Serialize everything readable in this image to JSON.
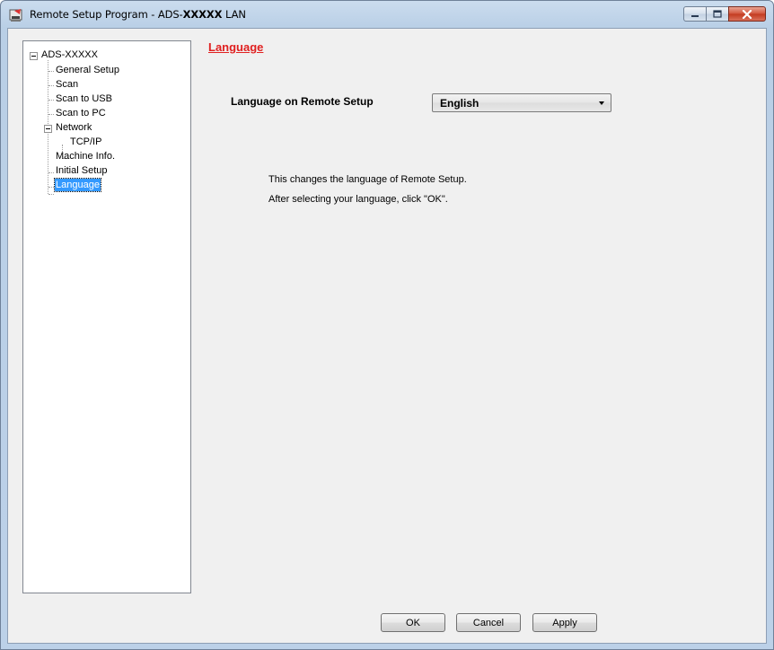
{
  "window": {
    "title_prefix": "Remote Setup Program - ADS-",
    "title_model": "XXXXX",
    "title_suffix": " LAN",
    "controls": {
      "minimize": "minimize-icon",
      "maximize": "maximize-icon",
      "close": "close-icon"
    }
  },
  "tree": {
    "root": "ADS-XXXXX",
    "items": [
      {
        "label": "General Setup"
      },
      {
        "label": "Scan"
      },
      {
        "label": "Scan to USB"
      },
      {
        "label": "Scan to PC"
      },
      {
        "label": "Network"
      },
      {
        "label": "TCP/IP"
      },
      {
        "label": "Machine Info."
      },
      {
        "label": "Initial Setup"
      },
      {
        "label": "Language"
      }
    ],
    "selected": "Language"
  },
  "content": {
    "section_title": "Language",
    "field_label": "Language on Remote Setup",
    "language_select": {
      "value": "English"
    },
    "info_line1": "This changes the language of Remote Setup.",
    "info_line2": "After selecting your language, click \"OK\"."
  },
  "buttons": {
    "ok": "OK",
    "cancel": "Cancel",
    "apply": "Apply"
  },
  "colors": {
    "accent": "#e02020",
    "selection": "#3399ff"
  }
}
